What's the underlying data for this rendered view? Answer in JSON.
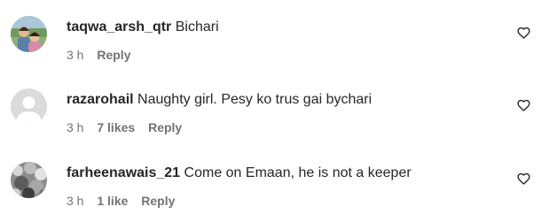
{
  "comments": [
    {
      "username": "taqwa_arsh_qtr",
      "text": "Bichari",
      "time": "3 h",
      "likes": "",
      "reply_label": "Reply",
      "avatar_icon": "profile-photo-two-children",
      "like_icon": "heart-outline-icon"
    },
    {
      "username": "razarohail",
      "text": "Naughty girl. Pesy ko trus gai bychari",
      "time": "3 h",
      "likes": "7 likes",
      "reply_label": "Reply",
      "avatar_icon": "default-profile-silhouette",
      "like_icon": "heart-outline-icon"
    },
    {
      "username": "farheenawais_21",
      "text": "Come on Emaan, he is not a keeper",
      "time": "3 h",
      "likes": "1 like",
      "reply_label": "Reply",
      "avatar_icon": "profile-photo-grayscale",
      "like_icon": "heart-outline-icon"
    }
  ],
  "colors": {
    "primary_text": "#262626",
    "secondary_text": "#737373",
    "background": "#ffffff",
    "default_avatar_bg": "#dbdbdb",
    "default_avatar_fg": "#ffffff"
  }
}
